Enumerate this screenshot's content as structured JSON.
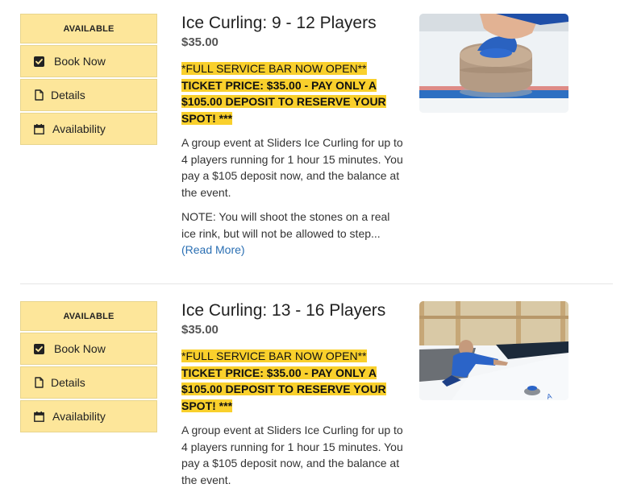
{
  "items": [
    {
      "status": "AVAILABLE",
      "book_label": "Book Now",
      "details_label": "Details",
      "availability_label": "Availability",
      "title": "Ice Curling: 9 - 12 Players",
      "price": "$35.00",
      "promo_line1": "*FULL SERVICE BAR NOW OPEN**",
      "promo_line2": "TICKET PRICE: $35.00 - PAY ONLY A $105.00 DEPOSIT TO RESERVE YOUR SPOT! ***",
      "description": "A group event at Sliders Ice Curling for up to 4 players running for 1 hour 15 minutes. You pay a $105 deposit now, and the balance at the event.",
      "note": "NOTE: You will shoot the stones on a real ice rink, but will not be allowed to step...",
      "read_more": "(Read More)"
    },
    {
      "status": "AVAILABLE",
      "book_label": "Book Now",
      "details_label": "Details",
      "availability_label": "Availability",
      "title": "Ice Curling: 13 - 16 Players",
      "price": "$35.00",
      "promo_line1": "*FULL SERVICE BAR NOW OPEN**",
      "promo_line2": "TICKET PRICE: $35.00 - PAY ONLY A $105.00 DEPOSIT TO RESERVE YOUR SPOT! ***",
      "description": "A group event at Sliders Ice Curling for up to 4 players running for 1 hour 15 minutes. You pay a $105 deposit now, and the balance at the event."
    }
  ],
  "colors": {
    "button_bg": "#fde69a",
    "highlight": "#f9d02c",
    "link": "#2a6fb3"
  },
  "icons": {
    "book": "check-square-icon",
    "details": "file-icon",
    "availability": "calendar-icon"
  }
}
